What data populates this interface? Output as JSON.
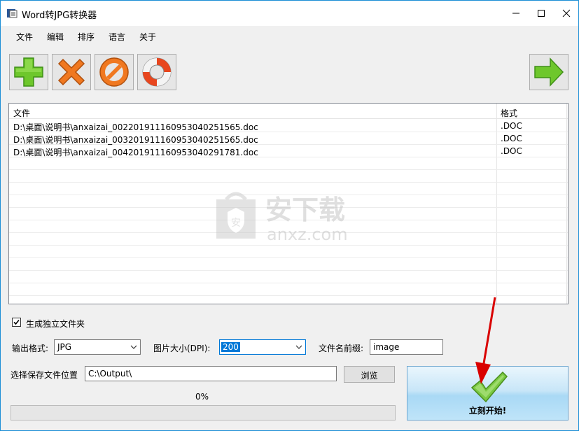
{
  "window": {
    "title": "Word转JPG转换器"
  },
  "menu": [
    "文件",
    "编辑",
    "排序",
    "语言",
    "关于"
  ],
  "toolbar": {
    "buttons": [
      {
        "name": "add",
        "icon": "plus-icon",
        "color": "#6ec72c"
      },
      {
        "name": "remove",
        "icon": "x-icon",
        "color": "#f07820"
      },
      {
        "name": "clear",
        "icon": "no-entry-icon",
        "color": "#f07820"
      },
      {
        "name": "help",
        "icon": "lifebuoy-icon",
        "color": "#e8461e"
      },
      {
        "name": "next",
        "icon": "arrow-right-icon",
        "color": "#6ec72c"
      }
    ]
  },
  "file_list": {
    "columns": [
      "文件",
      "格式"
    ],
    "rows": [
      {
        "file": "D:\\桌面\\说明书\\anxaizai_0022019111609530402​51565.doc",
        "format": ".DOC"
      },
      {
        "file": "D:\\桌面\\说明书\\anxaizai_003201911160953040251565.doc",
        "format": ".DOC"
      },
      {
        "file": "D:\\桌面\\说明书\\anxaizai_004201911160953040291781.doc",
        "format": ".DOC"
      }
    ]
  },
  "watermark": {
    "text_cn": "安下载",
    "text_en": "anxz.com"
  },
  "options": {
    "separate_folder_label": "生成独立文件夹",
    "separate_folder_checked": true,
    "output_format_label": "输出格式:",
    "output_format_value": "JPG",
    "image_size_label": "图片大小(DPI):",
    "image_size_value": "200",
    "filename_prefix_label": "文件名前缀:",
    "filename_prefix_value": "image",
    "save_location_label": "选择保存文件位置",
    "save_location_value": "C:\\Output\\",
    "browse_label": "浏览"
  },
  "progress": {
    "percent_text": "0%",
    "value": 0
  },
  "start_button": {
    "label": "立刻开始!"
  }
}
